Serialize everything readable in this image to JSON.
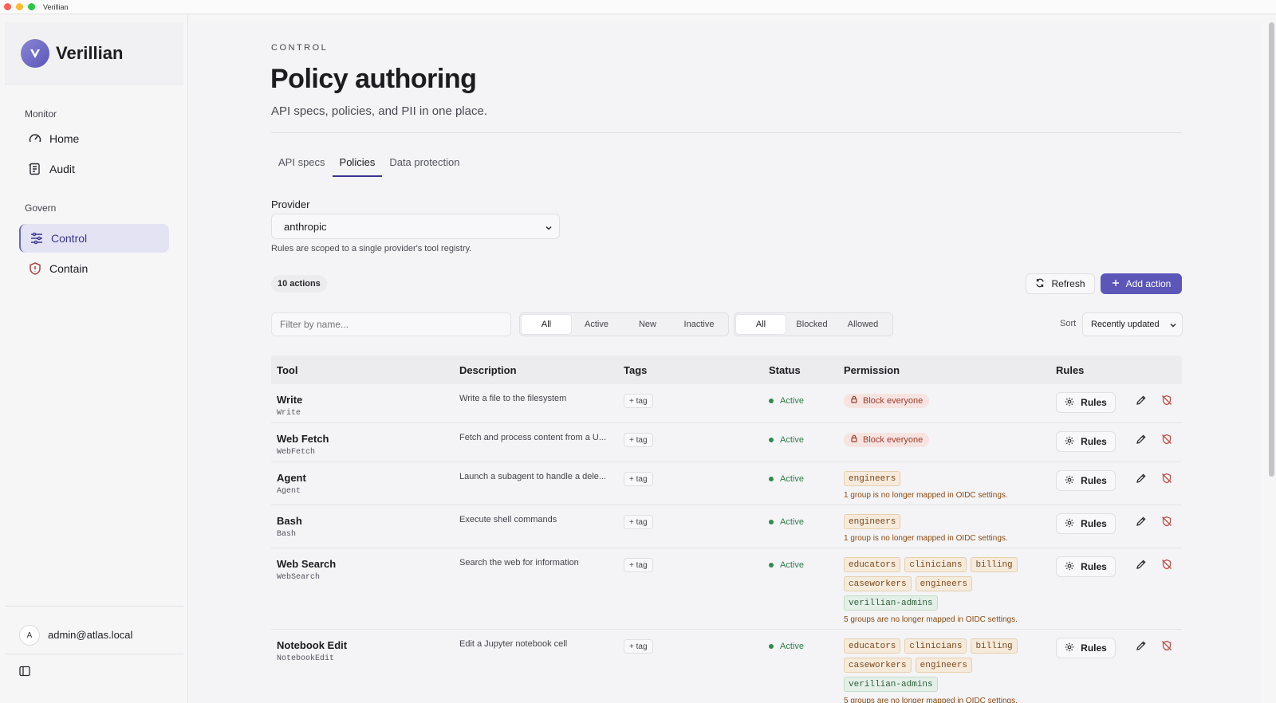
{
  "window": {
    "title": "Verillian"
  },
  "brand": {
    "name": "Verillian"
  },
  "sidebar": {
    "sections": [
      {
        "label": "Monitor",
        "items": [
          {
            "label": "Home",
            "icon": "gauge-icon"
          },
          {
            "label": "Audit",
            "icon": "scroll-icon"
          }
        ]
      },
      {
        "label": "Govern",
        "items": [
          {
            "label": "Control",
            "icon": "sliders-icon",
            "active": true
          },
          {
            "label": "Contain",
            "icon": "shield-icon"
          }
        ]
      }
    ],
    "user": {
      "initial": "A",
      "email": "admin@atlas.local"
    }
  },
  "header": {
    "eyebrow": "CONTROL",
    "title": "Policy authoring",
    "subtitle": "API specs, policies, and PII in one place."
  },
  "tabs": [
    {
      "label": "API specs",
      "active": false
    },
    {
      "label": "Policies",
      "active": true
    },
    {
      "label": "Data protection",
      "active": false
    }
  ],
  "provider": {
    "label": "Provider",
    "value": "anthropic",
    "hint": "Rules are scoped to a single provider's tool registry."
  },
  "toolbar": {
    "count": "10 actions",
    "refresh_label": "Refresh",
    "add_label": "Add action",
    "filter_placeholder": "Filter by name...",
    "state_filters": [
      "All",
      "Active",
      "New",
      "Inactive"
    ],
    "permission_filters": [
      "All",
      "Blocked",
      "Allowed"
    ],
    "sort_label": "Sort",
    "sort_value": "Recently updated"
  },
  "table": {
    "headers": [
      "Tool",
      "Description",
      "Tags",
      "Status",
      "Permission",
      "Rules"
    ],
    "tag_label": "+ tag",
    "rules_label": "Rules",
    "rows": [
      {
        "name": "Write",
        "id": "Write",
        "description": "Write a file to the filesystem",
        "status": "Active",
        "block": "Block everyone"
      },
      {
        "name": "Web Fetch",
        "id": "WebFetch",
        "description": "Fetch and process content from a U...",
        "status": "Active",
        "block": "Block everyone"
      },
      {
        "name": "Agent",
        "id": "Agent",
        "description": "Launch a subagent to handle a dele...",
        "status": "Active",
        "chips": [
          {
            "text": "engineers",
            "tone": "warn"
          }
        ],
        "note": "1 group is no longer mapped in OIDC settings."
      },
      {
        "name": "Bash",
        "id": "Bash",
        "description": "Execute shell commands",
        "status": "Active",
        "chips": [
          {
            "text": "engineers",
            "tone": "warn"
          }
        ],
        "note": "1 group is no longer mapped in OIDC settings."
      },
      {
        "name": "Web Search",
        "id": "WebSearch",
        "description": "Search the web for information",
        "status": "Active",
        "chips": [
          {
            "text": "educators",
            "tone": "warn"
          },
          {
            "text": "clinicians",
            "tone": "warn"
          },
          {
            "text": "billing",
            "tone": "warn"
          },
          {
            "text": "caseworkers",
            "tone": "warn"
          },
          {
            "text": "engineers",
            "tone": "warn"
          },
          {
            "text": "verillian-admins",
            "tone": "ok"
          }
        ],
        "note": "5 groups are no longer mapped in OIDC settings."
      },
      {
        "name": "Notebook Edit",
        "id": "NotebookEdit",
        "description": "Edit a Jupyter notebook cell",
        "status": "Active",
        "chips": [
          {
            "text": "educators",
            "tone": "warn"
          },
          {
            "text": "clinicians",
            "tone": "warn"
          },
          {
            "text": "billing",
            "tone": "warn"
          },
          {
            "text": "caseworkers",
            "tone": "warn"
          },
          {
            "text": "engineers",
            "tone": "warn"
          },
          {
            "text": "verillian-admins",
            "tone": "ok"
          }
        ],
        "note": "5 groups are no longer mapped in OIDC settings."
      }
    ]
  },
  "colors": {
    "accent": "#5b56b8",
    "active_status": "#2e8b4f",
    "danger": "#9a3b2c",
    "warning_text": "#8a4a12"
  }
}
